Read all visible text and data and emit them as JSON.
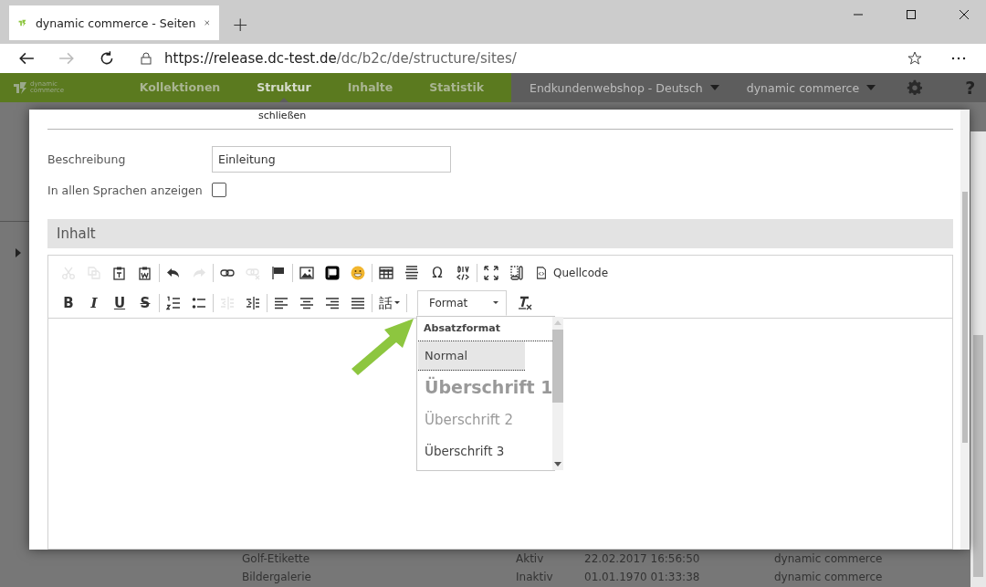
{
  "browser": {
    "tab": {
      "title": "dynamic commerce - Seiten"
    },
    "new_tab": "+",
    "url": {
      "host": "https://release.dc-test.de",
      "path": "/dc/b2c/de/structure/sites/"
    }
  },
  "app_nav": {
    "logo": {
      "line1": "dynamic",
      "line2": "commerce"
    },
    "menu": [
      {
        "label": "Kollektionen",
        "selected": false
      },
      {
        "label": "Struktur",
        "selected": true
      },
      {
        "label": "Inhalte",
        "selected": false
      },
      {
        "label": "Statistik",
        "selected": false
      }
    ],
    "shop_selector": "Endkundenwebshop - Deutsch",
    "user_selector": "dynamic commerce",
    "help": "?"
  },
  "background_rows": [
    {
      "title": "Golf-Etikette",
      "status": "Aktiv",
      "date": "22.02.2017 16:56:50",
      "author": "dynamic commerce"
    },
    {
      "title": "Bildergalerie",
      "status": "Inaktiv",
      "date": "01.01.1970 01:33:38",
      "author": "dynamic commerce"
    }
  ],
  "dialog": {
    "close_label": "schließen",
    "fields": [
      {
        "kind": "text",
        "label": "Beschreibung",
        "value": "Einleitung"
      },
      {
        "kind": "checkbox",
        "label": "In allen Sprachen anzeigen",
        "checked": false
      }
    ],
    "section_title": "Inhalt",
    "toolbar_rows": [
      [
        [
          {
            "kind": "icon",
            "disabled": true
          },
          {
            "kind": "icon",
            "disabled": true
          },
          {
            "kind": "icon",
            "disabled": false
          },
          {
            "kind": "icon",
            "disabled": false
          }
        ],
        [
          {
            "kind": "icon",
            "disabled": false
          },
          {
            "kind": "icon",
            "disabled": true
          }
        ],
        [
          {
            "kind": "icon",
            "disabled": false
          },
          {
            "kind": "icon",
            "disabled": true
          },
          {
            "kind": "icon",
            "disabled": false
          }
        ],
        [
          {
            "kind": "icon",
            "disabled": false
          },
          {
            "kind": "icon",
            "disabled": false
          },
          {
            "kind": "icon",
            "disabled": false
          }
        ],
        [
          {
            "kind": "icon",
            "disabled": false
          },
          {
            "kind": "icon",
            "disabled": false
          },
          {
            "kind": "glyph",
            "glyph": "Ω",
            "disabled": false
          },
          {
            "kind": "icon",
            "disabled": false
          }
        ],
        [
          {
            "kind": "icon",
            "disabled": false
          },
          {
            "kind": "icon",
            "disabled": false
          },
          {
            "kind": "labeled",
            "label": "Quellcode",
            "disabled": false
          }
        ]
      ],
      [
        [
          {
            "kind": "bold",
            "glyph": "B",
            "disabled": false
          },
          {
            "kind": "italic",
            "glyph": "I",
            "disabled": false
          },
          {
            "kind": "underline",
            "glyph": "U",
            "disabled": false
          },
          {
            "kind": "strike",
            "glyph": "S",
            "disabled": false
          }
        ],
        [
          {
            "kind": "icon",
            "disabled": false
          },
          {
            "kind": "icon",
            "disabled": false
          }
        ],
        [
          {
            "kind": "icon",
            "disabled": true
          },
          {
            "kind": "icon",
            "disabled": false
          }
        ],
        [
          {
            "kind": "icon",
            "disabled": false
          },
          {
            "kind": "icon",
            "disabled": false
          },
          {
            "kind": "icon",
            "disabled": false
          },
          {
            "kind": "icon",
            "disabled": false
          }
        ],
        [
          {
            "kind": "menu",
            "glyph": "話",
            "disabled": false
          }
        ],
        [
          {
            "kind": "format"
          },
          {
            "kind": "icon",
            "disabled": false
          }
        ]
      ]
    ],
    "format": {
      "label": "Format",
      "expanded": true,
      "header": "Absatzformat",
      "options": [
        {
          "kind": "p",
          "label": "Normal",
          "selected": true
        },
        {
          "kind": "h1",
          "label": "Überschrift 1",
          "selected": false
        },
        {
          "kind": "h2",
          "label": "Überschrift 2",
          "selected": false
        },
        {
          "kind": "h3",
          "label": "Überschrift 3",
          "selected": false
        }
      ]
    }
  }
}
